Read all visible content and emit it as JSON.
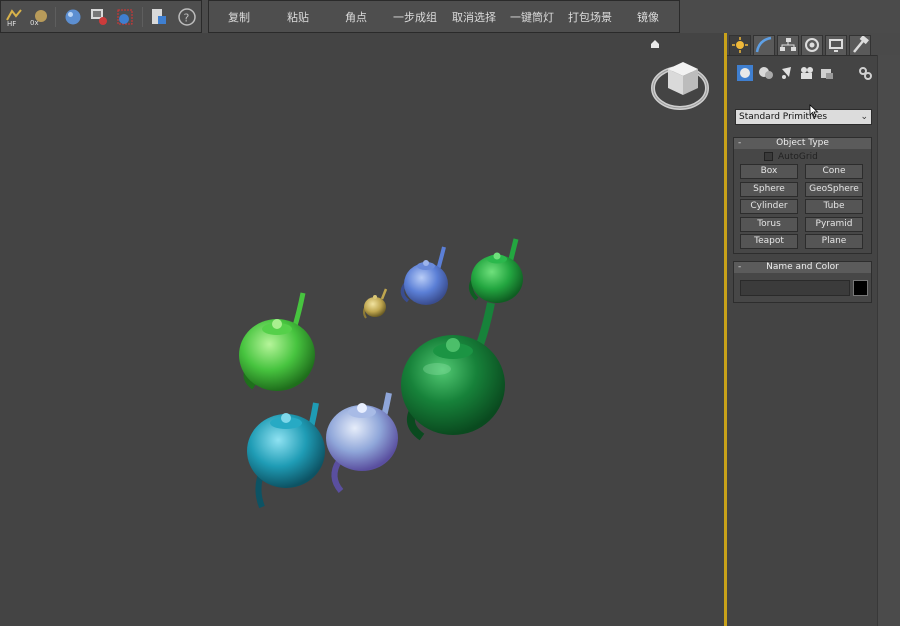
{
  "toolbar": {
    "left_icons": [
      "hf-icon",
      "ox-icon",
      "sphere-icon",
      "render-setup-icon",
      "render-frame-icon",
      "export-icon",
      "help-icon"
    ],
    "buttons": [
      {
        "name": "copy-button",
        "label": "复制"
      },
      {
        "name": "paste-button",
        "label": "粘贴"
      },
      {
        "name": "corner-button",
        "label": "角点"
      },
      {
        "name": "one-step-group-button",
        "label": "一步成组"
      },
      {
        "name": "cancel-selection-button",
        "label": "取消选择"
      },
      {
        "name": "one-click-light-button",
        "label": "一键筒灯"
      },
      {
        "name": "pack-scene-button",
        "label": "打包场景"
      },
      {
        "name": "mirror-button",
        "label": "镜像"
      }
    ]
  },
  "viewport": {
    "teapots": [
      {
        "name": "teapot-gold-small",
        "color": "#c9b45a"
      },
      {
        "name": "teapot-blue-small",
        "color": "#5b7fd6"
      },
      {
        "name": "teapot-green-back",
        "color": "#23a640"
      },
      {
        "name": "teapot-green-light",
        "color": "#47c43f"
      },
      {
        "name": "teapot-green-large",
        "color": "#17823a"
      },
      {
        "name": "teapot-cyan",
        "color": "#1f9cb5"
      },
      {
        "name": "teapot-lavender",
        "color": "#8fa6d9"
      }
    ],
    "accent_border": "#c9a21a"
  },
  "command_panel": {
    "tabs": [
      "create-tab",
      "modify-tab",
      "hierarchy-tab",
      "motion-tab",
      "display-tab",
      "utilities-tab"
    ],
    "sub_icons": [
      "geometry-icon",
      "shapes-icon",
      "lights-icon",
      "cameras-icon",
      "helpers-icon",
      "systems-icon"
    ],
    "category": "Standard Primitives",
    "object_type": {
      "title": "Object Type",
      "autogrid": "AutoGrid",
      "buttons": [
        "Box",
        "Cone",
        "Sphere",
        "GeoSphere",
        "Cylinder",
        "Tube",
        "Torus",
        "Pyramid",
        "Teapot",
        "Plane"
      ]
    },
    "name_color": {
      "title": "Name and Color",
      "name_value": "",
      "color": "#000000"
    }
  }
}
